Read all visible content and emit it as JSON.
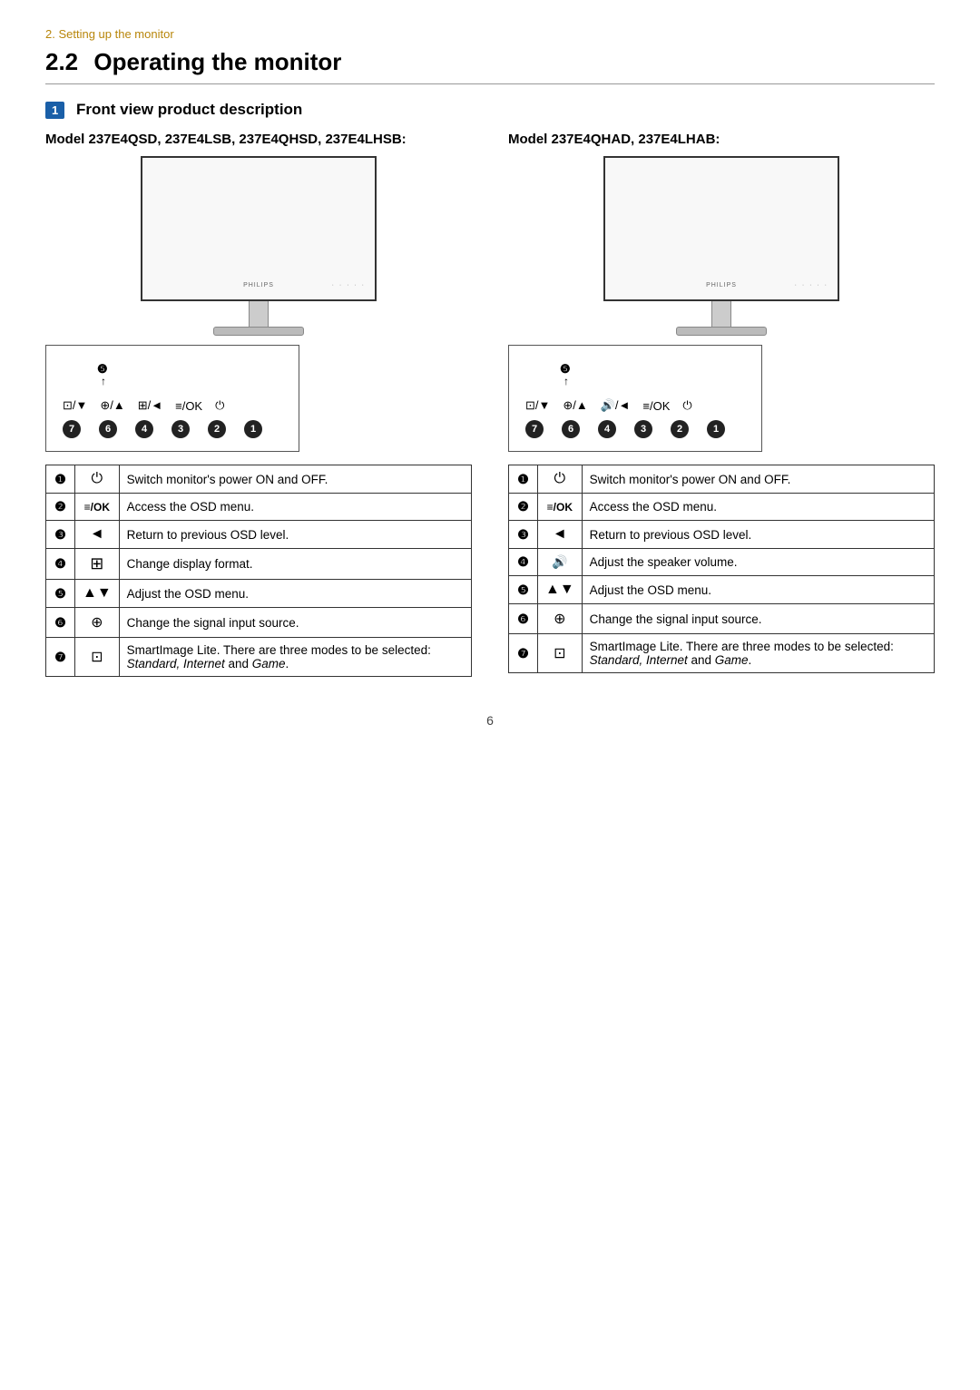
{
  "breadcrumb": "2. Setting up the monitor",
  "section": {
    "number": "2.2",
    "title": "Operating the monitor"
  },
  "badge": "1",
  "front_view_label": "Front view product description",
  "col_left": {
    "model_label": "Model 237E4QSD, 237E4LSB, 237E4QHSD, 237E4LHSB:",
    "brand": "PHILIPS",
    "button_numbers": [
      "7",
      "6",
      "4",
      "3",
      "2",
      "1"
    ],
    "table_rows": [
      {
        "num": "❶",
        "icon": "⏻",
        "desc": "Switch monitor's power ON and OFF."
      },
      {
        "num": "❷",
        "icon": "≡/OK",
        "desc": "Access the OSD menu."
      },
      {
        "num": "❸",
        "icon": "◄",
        "desc": "Return to previous OSD level."
      },
      {
        "num": "❹",
        "icon": "⊞",
        "desc": "Change display format."
      },
      {
        "num": "❺",
        "icon": "▲▼",
        "desc": "Adjust the OSD menu."
      },
      {
        "num": "❻",
        "icon": "⊕",
        "desc": "Change the signal input source."
      },
      {
        "num": "❼",
        "icon": "⊡",
        "desc": "SmartImage Lite. There are three modes to be selected: Standard, Internet and Game."
      }
    ]
  },
  "col_right": {
    "model_label": "Model 237E4QHAD, 237E4LHAB:",
    "brand": "PHILIPS",
    "button_numbers": [
      "7",
      "6",
      "4",
      "3",
      "2",
      "1"
    ],
    "table_rows": [
      {
        "num": "❶",
        "icon": "⏻",
        "desc": "Switch monitor's power ON and OFF."
      },
      {
        "num": "❷",
        "icon": "≡/OK",
        "desc": "Access the OSD menu."
      },
      {
        "num": "❸",
        "icon": "◄",
        "desc": "Return to previous OSD level."
      },
      {
        "num": "❹",
        "icon": "🔊",
        "desc": "Adjust the speaker volume."
      },
      {
        "num": "❺",
        "icon": "▲▼",
        "desc": "Adjust the OSD menu."
      },
      {
        "num": "❻",
        "icon": "⊕",
        "desc": "Change the signal input source."
      },
      {
        "num": "❼",
        "icon": "⊡",
        "desc": "SmartImage Lite. There are three modes to be selected: Standard, Internet and Game."
      }
    ]
  },
  "page_number": "6"
}
